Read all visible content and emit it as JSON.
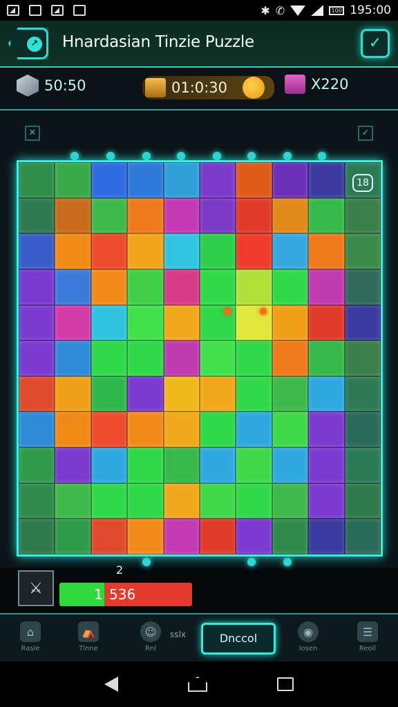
{
  "status_bar": {
    "time": "195:00",
    "battery": "100"
  },
  "header": {
    "title": "Hnardasian Tinzie Puzzle"
  },
  "stats": {
    "moves": "50:50",
    "timer": "01:0:30",
    "score": "X220"
  },
  "board": {
    "badge": "18",
    "hint_number": "2",
    "colors": [
      [
        "#2f8d4a",
        "#39a94a",
        "#2f6be0",
        "#2e7ad8",
        "#2f9fd8",
        "#7b39c9",
        "#e05a1a",
        "#6c2fb8",
        "#3c3aa0",
        "#2a7a56"
      ],
      [
        "#2f7a50",
        "#c86b1c",
        "#3fb84a",
        "#ee7a1a",
        "#c43ab2",
        "#7a3ac6",
        "#e03a2a",
        "#e08a1a",
        "#36b84a",
        "#3a7f4a"
      ],
      [
        "#3a5cc8",
        "#f08a16",
        "#ee4a2c",
        "#f1a51a",
        "#2fc4e0",
        "#2ecf48",
        "#f03a2a",
        "#36a8e0",
        "#ee7a1a",
        "#3a8a4a"
      ],
      [
        "#7a3ad0",
        "#3a7ad8",
        "#f28a1a",
        "#3fcf46",
        "#d83a8a",
        "#2fd848",
        "#b0e03a",
        "#2fd848",
        "#c03ab0",
        "#2f6a5a"
      ],
      [
        "#7b3ad0",
        "#d43aa8",
        "#2ec4e0",
        "#3fe04a",
        "#f1a81a",
        "#2fd848",
        "#e0e83a",
        "#f0a018",
        "#e03a2a",
        "#3a3aa0"
      ],
      [
        "#7b3ad0",
        "#2f8ad8",
        "#2fd848",
        "#2fd848",
        "#c03ab0",
        "#3fe04a",
        "#2fd848",
        "#ee7a1a",
        "#36b84a",
        "#3a7f4a"
      ],
      [
        "#e04a2c",
        "#f0a018",
        "#2fb84a",
        "#7b3ad0",
        "#f1b81a",
        "#f1a81a",
        "#2fd848",
        "#3fb84a",
        "#2fa8e0",
        "#2f7a55"
      ],
      [
        "#2f8ad8",
        "#f08a16",
        "#ee4a2c",
        "#f28a1a",
        "#f1a81a",
        "#2fd848",
        "#2fa8e0",
        "#3fd848",
        "#7b3ad0",
        "#2a6a5a"
      ],
      [
        "#2f9a4a",
        "#7b3ad0",
        "#2fa8e0",
        "#2fd848",
        "#36b84a",
        "#2fa8e0",
        "#3fd848",
        "#2fa8e0",
        "#7b3ad0",
        "#2a7a56"
      ],
      [
        "#2f8a4a",
        "#3fb84a",
        "#2fd848",
        "#2fd848",
        "#f1a81a",
        "#3fd848",
        "#2fd848",
        "#3fb84a",
        "#7b3ad0",
        "#2f7a4a"
      ],
      [
        "#2f7a4a",
        "#2f9a4a",
        "#e04a2c",
        "#f28a1a",
        "#c43ab2",
        "#e03a2a",
        "#7b3ad0",
        "#2f8a4a",
        "#3a3aa0",
        "#2a6a5a"
      ]
    ]
  },
  "progress": {
    "current": "1",
    "target": "536",
    "fraction": 0.34
  },
  "bottom_nav": {
    "items": [
      {
        "label": "Rasie",
        "icon": "home-icon"
      },
      {
        "label": "Tinne",
        "icon": "house-icon"
      },
      {
        "label": "Rnl",
        "icon": "face-icon"
      },
      {
        "label": "Iosen",
        "icon": "head-icon"
      },
      {
        "label": "Reoll",
        "icon": "list-icon"
      }
    ],
    "sub_label": "sslx",
    "main_button": "Dnccol"
  }
}
